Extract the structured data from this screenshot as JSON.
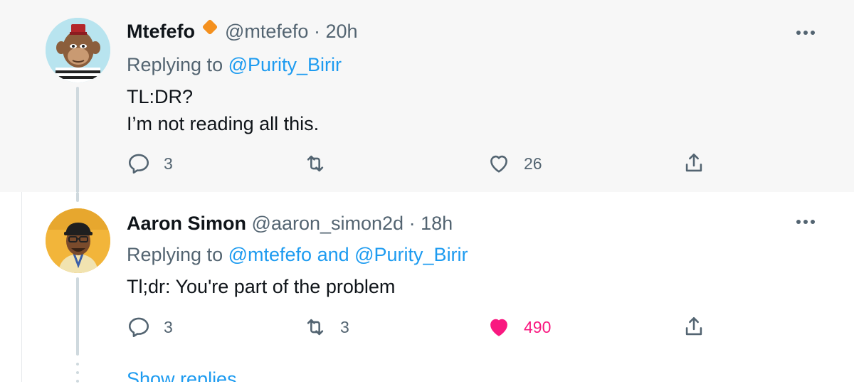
{
  "tweets": [
    {
      "display_name": "Mtefefo",
      "handle": "@mtefefo",
      "separator": "·",
      "time": "20h",
      "replying_prefix": "Replying to",
      "replying_to": "@Purity_Birir",
      "body_lines": [
        "TL:DR?",
        "I’m not reading all this."
      ],
      "reply_count": "3",
      "retweet_count": "",
      "like_count": "26",
      "liked": false,
      "avatar_icon": "ape-avatar-icon",
      "badge_icon": "orange-diamond-badge-icon"
    },
    {
      "display_name": "Aaron Simon",
      "handle": "@aaron_simon2d",
      "separator": "·",
      "time": "18h",
      "replying_prefix": "Replying to",
      "replying_to": "@mtefefo and @Purity_Birir",
      "body_lines": [
        "Tl;dr: You're part of the problem"
      ],
      "reply_count": "3",
      "retweet_count": "3",
      "like_count": "490",
      "liked": true,
      "avatar_icon": "user-photo-avatar"
    }
  ],
  "show_replies_label": "Show replies",
  "colors": {
    "link": "#1d9bf0",
    "secondary_text": "#536471",
    "like_active": "#f91880",
    "badge": "#f4901e",
    "highlight_bg": "#f7f7f7"
  }
}
